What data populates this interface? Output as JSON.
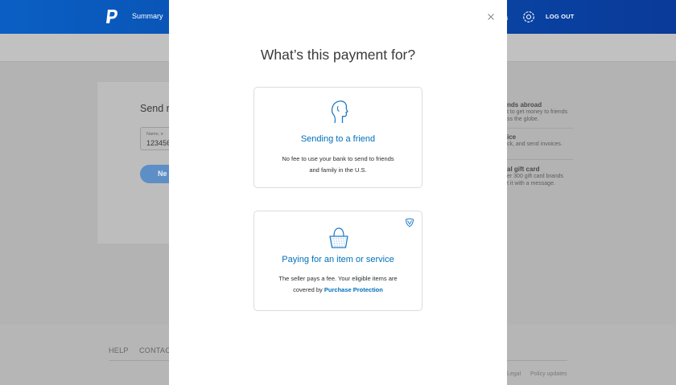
{
  "header": {
    "nav_summary": "Summary",
    "logout": "LOG OUT",
    "brand_color": "#0a4fb4"
  },
  "background_page": {
    "heading": "Send m",
    "field_label": "Name, e",
    "field_value": "123456",
    "next_button": "Ne",
    "side_items": [
      {
        "title": "nds abroad",
        "lines": [
          "t to get money to friends",
          "ss the globe."
        ]
      },
      {
        "title": "ice",
        "lines": [
          "ck, and send invoices."
        ]
      },
      {
        "title": "al gift card",
        "lines": [
          "er 300 gift card brands",
          "t it with a message."
        ]
      }
    ],
    "footer": {
      "help": "HELP",
      "contact": "CONTAC",
      "legal": "Legal",
      "policy": "Policy updates"
    }
  },
  "modal": {
    "title": "What’s this payment for?",
    "options": [
      {
        "title": "Sending to a friend",
        "desc_line1": "No fee to use your bank to send to friends",
        "desc_line2": "and family in the U.S.",
        "icon": "friend-head-icon"
      },
      {
        "title": "Paying for an item or service",
        "desc_line1": "The seller pays a fee. Your eligible items are",
        "desc_line2_prefix": "covered by",
        "link": "Purchase Protection",
        "icon": "shopping-basket-icon",
        "badge_icon": "shield-icon"
      }
    ],
    "accent_color": "#0070ba"
  }
}
